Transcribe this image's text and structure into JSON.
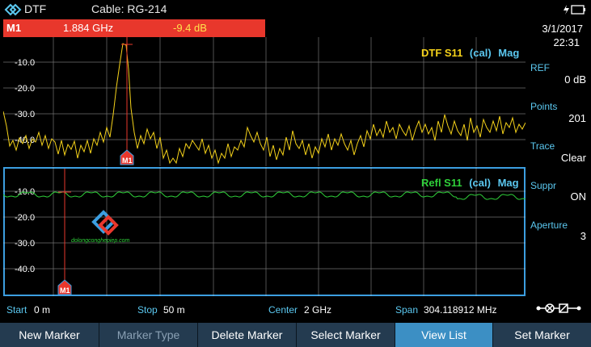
{
  "header": {
    "app_name": "DTF",
    "cable": "Cable: RG-214"
  },
  "marker_readout": {
    "name": "M1",
    "frequency": "1.884 GHz",
    "level": "-9.4 dB"
  },
  "datetime": {
    "date": "3/1/2017",
    "time": "22:31"
  },
  "side_panel": [
    {
      "label": "REF",
      "value": "0 dB"
    },
    {
      "label": "Points",
      "value": "201"
    },
    {
      "label": "Trace",
      "value": "Clear"
    },
    {
      "label": "Suppr",
      "value": "ON"
    },
    {
      "label": "Aperture",
      "value": "3"
    }
  ],
  "top_plot": {
    "title_a": "DTF S11",
    "title_b": "(cal)",
    "title_c": "Mag",
    "y_ticks": [
      "-10.0",
      "-20.0",
      "-30.0",
      "-40.0"
    ],
    "marker_label": "M1"
  },
  "bottom_plot": {
    "title_a": "Refl S11",
    "title_b": "(cal)",
    "title_c": "Mag",
    "y_ticks": [
      "-10.0",
      "-20.0",
      "-30.0",
      "-40.0"
    ],
    "marker_label": "M1",
    "watermark": "dolongconghepiep.com"
  },
  "status": {
    "start_label": "Start",
    "start_value": "0 m",
    "stop_label": "Stop",
    "stop_value": "50 m",
    "center_label": "Center",
    "center_value": "2 GHz",
    "span_label": "Span",
    "span_value": "304.118912 MHz"
  },
  "softkeys": [
    {
      "label": "New Marker",
      "state": "normal"
    },
    {
      "label": "Marker Type",
      "state": "disabled"
    },
    {
      "label": "Delete Marker",
      "state": "normal"
    },
    {
      "label": "Select Marker",
      "state": "normal"
    },
    {
      "label": "View List",
      "state": "active"
    },
    {
      "label": "Set Marker",
      "state": "normal"
    }
  ],
  "colors": {
    "accent_blue": "#3c9ee0",
    "marker_red": "#e8372c",
    "trace_yellow": "#f5d21a",
    "trace_green": "#2fd13a",
    "label_cyan": "#5bc8f0"
  }
}
